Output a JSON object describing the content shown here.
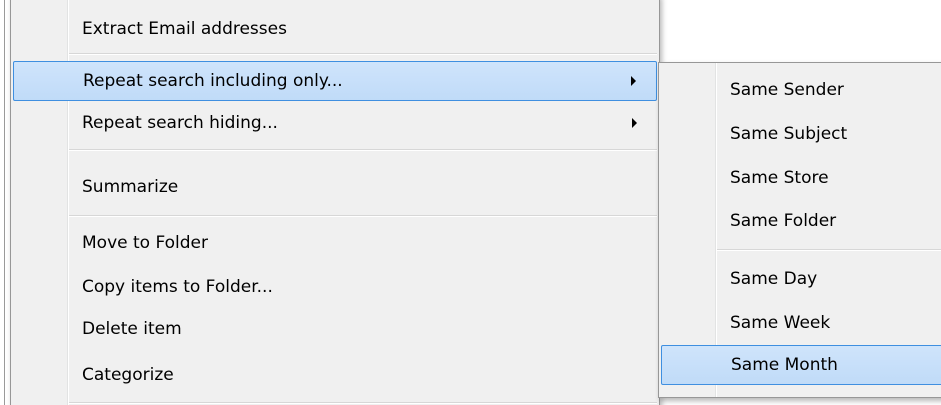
{
  "context_menu": {
    "items": [
      {
        "label": "Extract Email addresses"
      },
      {
        "label": "Repeat search including only...",
        "has_submenu": true,
        "highlighted": true
      },
      {
        "label": "Repeat search hiding...",
        "has_submenu": true
      },
      {
        "label": "Summarize"
      },
      {
        "label": "Move to Folder"
      },
      {
        "label": "Copy items to Folder..."
      },
      {
        "label": "Delete item"
      },
      {
        "label": "Categorize"
      }
    ]
  },
  "submenu": {
    "items": [
      {
        "label": "Same Sender"
      },
      {
        "label": "Same Subject"
      },
      {
        "label": "Same Store"
      },
      {
        "label": "Same Folder"
      },
      {
        "label": "Same Day"
      },
      {
        "label": "Same Week"
      },
      {
        "label": "Same Month",
        "highlighted": true
      }
    ]
  },
  "colors": {
    "menu_background": "#f0f0f0",
    "menu_border": "#979797",
    "highlight_fill": "#c8e0fa",
    "highlight_border": "#3f8fe0"
  }
}
